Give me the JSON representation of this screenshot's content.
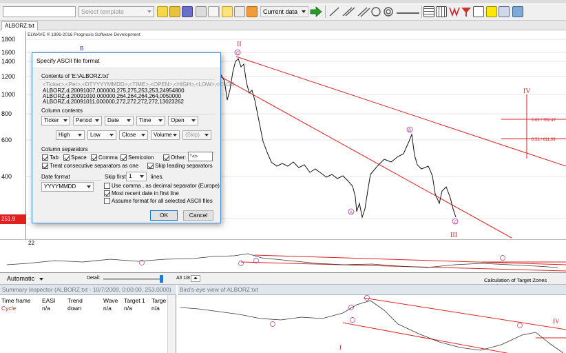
{
  "toolbar": {
    "template_placeholder": "Select template",
    "period": "Current data"
  },
  "tab": {
    "title": "ALBORZ.txt"
  },
  "chart": {
    "copyright": "ELWAVE ® 1996-2016 Prognosis Software Development",
    "y_ticks": [
      "1800",
      "1600",
      "1400",
      "1200",
      "1000",
      "800",
      "600",
      "400"
    ],
    "date_left": "22",
    "price_badge": "251.9",
    "level_1": "0.62 / 762.47",
    "level_2": "0.51 / 611.09",
    "wave_labels": {
      "II": "II",
      "III": "III",
      "IV": "IV",
      "B": "B",
      "C": "C",
      "A": "A"
    },
    "colors": {
      "accent": "#cc1f1f",
      "wave": "#b0309a",
      "blue_wave": "#2233aa"
    }
  },
  "status": {
    "scale": "Automatic",
    "detail": "Detail:",
    "alt": "Alt 1/8",
    "message": "Calculation of Target Zones completed."
  },
  "inspector": {
    "title": "Summary Inspector (ALBORZ.txt - 10/7/2009, 0:00:00, 253.0000)",
    "headers": [
      "Time frame",
      "EASI",
      "Trend",
      "Wave",
      "Target 1",
      "Targe"
    ],
    "row": [
      "Cycle",
      "n/a",
      "down",
      "n/a",
      "n/a",
      "n/a"
    ]
  },
  "birdseye": {
    "title": "Bird's-eye view of ALBORZ.txt",
    "label_I": "I",
    "label_IV": "IV"
  },
  "dialog": {
    "title": "Specify ASCII file format",
    "contents_label": "Contents of 'E:\\ALBORZ.txt'",
    "preview": [
      "<Ticker>,<Per>,<DTYYYYMMDD>,<TIME>,<OPEN>,<HIGH>,<LOW>,<CLOS...",
      "ALBORZ,d,20091007,000000,275,275,253,253,24954800",
      "ALBORZ,d,20091010,000000,264,264,264,264,0050000",
      "ALBORZ,d,20091011,000000,272,272,272,272,13023262"
    ],
    "column_contents_label": "Column contents",
    "columns_row1": [
      "Ticker",
      "Period",
      "Date",
      "Time",
      "Open"
    ],
    "columns_row2": [
      "High",
      "Low",
      "Close",
      "Volume",
      "(Skip)"
    ],
    "separators_label": "Column separators",
    "sep_tab": "Tab",
    "sep_space": "Space",
    "sep_comma": "Comma",
    "sep_semicolon": "Semicolon",
    "sep_other": "Other:",
    "sep_other_value": "\"<>",
    "treat_consecutive": "Treat consecutive separators as one",
    "skip_leading": "Skip leading separators",
    "date_format_label": "Date format",
    "date_format_value": "YYYYMMDD",
    "skip_first_label": "Skip first",
    "skip_first_value": "1",
    "lines_label": "lines.",
    "use_comma": "Use comma  ,  as decimal separator (Europe)",
    "most_recent": "Most recent date in first line",
    "assume_format": "Assume format for all selected ASCII files",
    "ok": "OK",
    "cancel": "Cancel"
  }
}
